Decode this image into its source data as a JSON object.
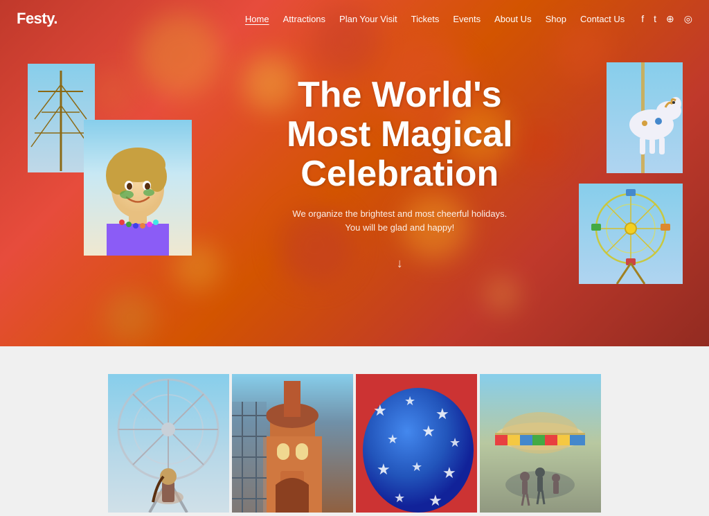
{
  "header": {
    "logo": "Festy.",
    "nav": [
      {
        "label": "Home",
        "active": true
      },
      {
        "label": "Attractions",
        "active": false
      },
      {
        "label": "Plan Your Visit",
        "active": false
      },
      {
        "label": "Tickets",
        "active": false
      },
      {
        "label": "Events",
        "active": false
      },
      {
        "label": "About Us",
        "active": false
      },
      {
        "label": "Shop",
        "active": false
      },
      {
        "label": "Contact Us",
        "active": false
      }
    ],
    "social": [
      {
        "name": "facebook-icon",
        "glyph": "f"
      },
      {
        "name": "twitter-icon",
        "glyph": "t"
      },
      {
        "name": "pinterest-icon",
        "glyph": "⊕"
      },
      {
        "name": "instagram-icon",
        "glyph": "◎"
      }
    ]
  },
  "hero": {
    "title": "The World's\nMost Magical\nCelebration",
    "subtitle_line1": "We organize the brightest and most cheerful holidays.",
    "subtitle_line2": "You will be glad and happy!",
    "arrow": "↓"
  },
  "gallery": {
    "items": [
      {
        "alt": "Ferris wheel with woman"
      },
      {
        "alt": "Amusement park entrance"
      },
      {
        "alt": "Blue star balloon"
      },
      {
        "alt": "Outdoor stage performance"
      }
    ]
  }
}
